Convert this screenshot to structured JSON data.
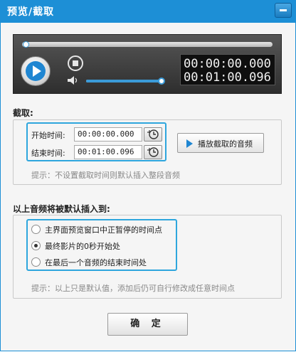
{
  "window": {
    "title": "预览/截取"
  },
  "player": {
    "current_time": "00:00:00.000",
    "total_time": "00:01:00.096",
    "progress": 0.0,
    "volume": 0.95,
    "accent_color": "#3b9bd8"
  },
  "capture": {
    "section_label": "截取:",
    "start_label": "开始时间:",
    "start_value": "00:00:00.000",
    "end_label": "结束时间:",
    "end_value": "00:01:00.096",
    "play_clip_label": "播放截取的音频",
    "hint": "提示：不设置截取时间则默认插入整段音频"
  },
  "insert": {
    "section_label": "以上音频将被默认插入到:",
    "options": [
      {
        "label": "主界面预览窗口中正暂停的时间点",
        "selected": false
      },
      {
        "label": "最终影片的0秒开始处",
        "selected": true
      },
      {
        "label": "在最后一个音频的结束时间处",
        "selected": false
      }
    ],
    "hint": "提示：以上只是默认值，添加后仍可自行修改成任意时间点"
  },
  "footer": {
    "ok_label": "确 定"
  },
  "icons": {
    "minimize": "minimize-icon",
    "play": "play-icon",
    "stop": "stop-icon",
    "volume": "speaker-icon",
    "time_picker": "clock-icon",
    "play_clip": "play-triangle-icon"
  },
  "colors": {
    "titlebar": "#1d8fd6",
    "highlight": "#2ea6dd"
  }
}
